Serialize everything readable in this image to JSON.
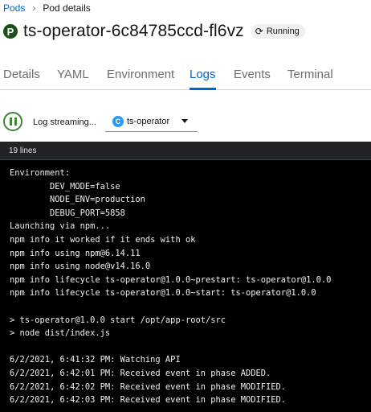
{
  "breadcrumb": {
    "parent": "Pods",
    "current": "Pod details"
  },
  "header": {
    "resource_badge": "P",
    "pod_name": "ts-operator-6c84785ccd-fl6vz",
    "status": "Running",
    "status_icon": "sync-icon"
  },
  "tabs": [
    {
      "label": "Details",
      "active": false
    },
    {
      "label": "YAML",
      "active": false
    },
    {
      "label": "Environment",
      "active": false
    },
    {
      "label": "Logs",
      "active": true
    },
    {
      "label": "Events",
      "active": false
    },
    {
      "label": "Terminal",
      "active": false
    }
  ],
  "toolbar": {
    "stream_label": "Log streaming...",
    "container_badge": "C",
    "container_name": "ts-operator"
  },
  "log": {
    "line_count": "19 lines",
    "lines": [
      "Environment:",
      "        DEV_MODE=false",
      "        NODE_ENV=production",
      "        DEBUG_PORT=5858",
      "Launching via npm...",
      "npm info it worked if it ends with ok",
      "npm info using npm@6.14.11",
      "npm info using node@v14.16.0",
      "npm info lifecycle ts-operator@1.0.0~prestart: ts-operator@1.0.0",
      "npm info lifecycle ts-operator@1.0.0~start: ts-operator@1.0.0",
      "",
      "> ts-operator@1.0.0 start /opt/app-root/src",
      "> node dist/index.js",
      "",
      "6/2/2021, 6:41:32 PM: Watching API",
      "6/2/2021, 6:42:01 PM: Received event in phase ADDED.",
      "6/2/2021, 6:42:02 PM: Received event in phase MODIFIED.",
      "6/2/2021, 6:42:03 PM: Received event in phase MODIFIED."
    ]
  },
  "colors": {
    "link": "#0066cc",
    "pod_badge": "#1e4f18",
    "streaming_green": "#3e8635",
    "container_badge": "#2b9af3",
    "log_background": "#000000",
    "log_header": "#212427"
  }
}
